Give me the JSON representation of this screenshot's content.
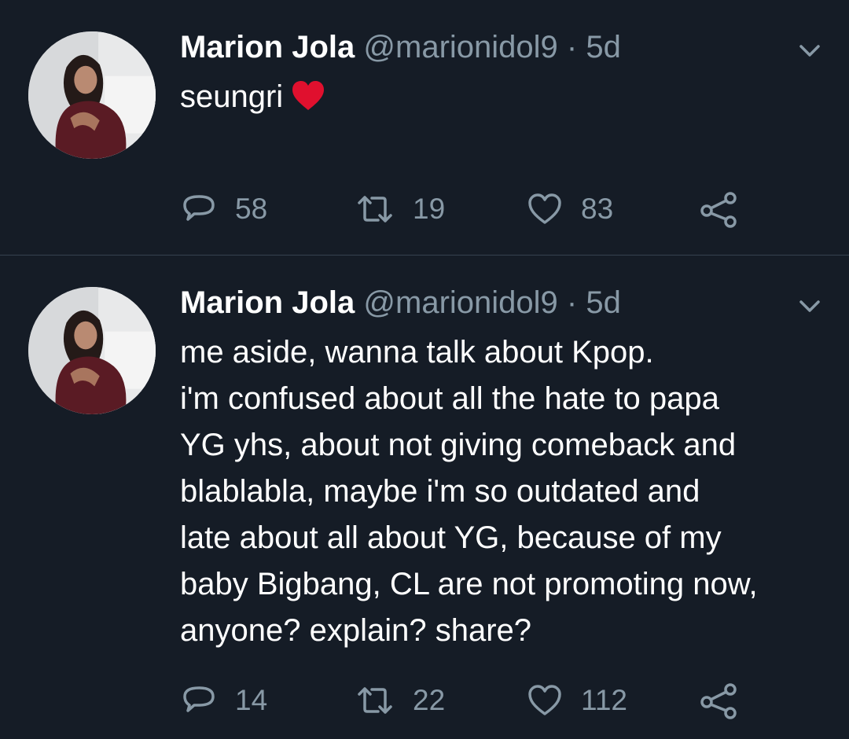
{
  "tweets": [
    {
      "name": "Marion Jola",
      "handle": "@marionidol9",
      "separator": "·",
      "time": "5d",
      "lines": [
        "seungri"
      ],
      "emoji": "red-heart-emoji",
      "replies": "58",
      "retweets": "19",
      "likes": "83"
    },
    {
      "name": "Marion Jola",
      "handle": "@marionidol9",
      "separator": "·",
      "time": "5d",
      "lines": [
        "me aside, wanna talk about Kpop.",
        "i'm confused about all the hate to papa",
        "YG yhs, about not giving comeback and",
        "blablabla, maybe i'm so outdated and",
        "late about all about YG, because of my",
        "baby Bigbang, CL are not promoting now,",
        "anyone? explain? share?"
      ],
      "replies": "14",
      "retweets": "22",
      "likes": "112"
    }
  ],
  "colors": {
    "background": "#151c26",
    "text": "#ffffff",
    "secondary": "#8899a6",
    "divider": "#36424f",
    "heart": "#e0102e"
  },
  "icons": [
    "chevron-down-icon",
    "reply-icon",
    "retweet-icon",
    "like-icon",
    "share-icon"
  ]
}
